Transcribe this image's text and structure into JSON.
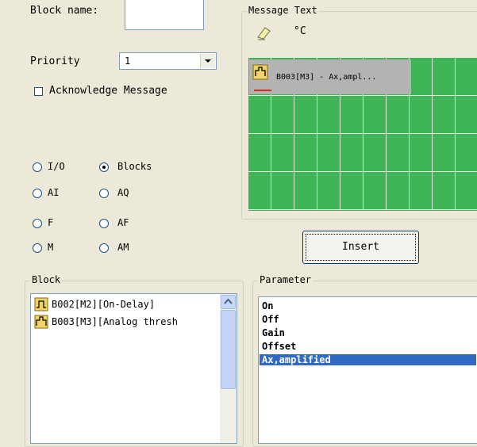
{
  "left_panel": {
    "block_name_label": "Block name:",
    "block_name_value": "",
    "priority_label": "Priority",
    "priority_value": "1",
    "acknowledge_label": "Acknowledge Message",
    "acknowledge_checked": false,
    "radios": [
      {
        "label": "I/O",
        "checked": false
      },
      {
        "label": "Blocks",
        "checked": true
      },
      {
        "label": "AI",
        "checked": false
      },
      {
        "label": "AQ",
        "checked": false
      },
      {
        "label": "F",
        "checked": false
      },
      {
        "label": "AF",
        "checked": false
      },
      {
        "label": "M",
        "checked": false
      },
      {
        "label": "AM",
        "checked": false
      }
    ]
  },
  "message_text": {
    "legend": "Message Text",
    "degree_symbol": "°C",
    "item_text": "B003[M3] - Ax,ampl..."
  },
  "insert_button": "Insert",
  "block_group": {
    "legend": "Block",
    "items": [
      {
        "label": "B002[M2][On-Delay]",
        "icon": "on-delay-icon"
      },
      {
        "label": "B003[M3][Analog thresh",
        "icon": "analog-threshold-icon"
      }
    ]
  },
  "parameter_group": {
    "legend": "Parameter",
    "items": [
      "On",
      "Off",
      "Gain",
      "Offset",
      "Ax,amplified"
    ],
    "selected_index": 4
  },
  "colors": {
    "grid_green": "#3fb454",
    "selection_blue": "#316ac5",
    "window_bg": "#ece9d8"
  }
}
